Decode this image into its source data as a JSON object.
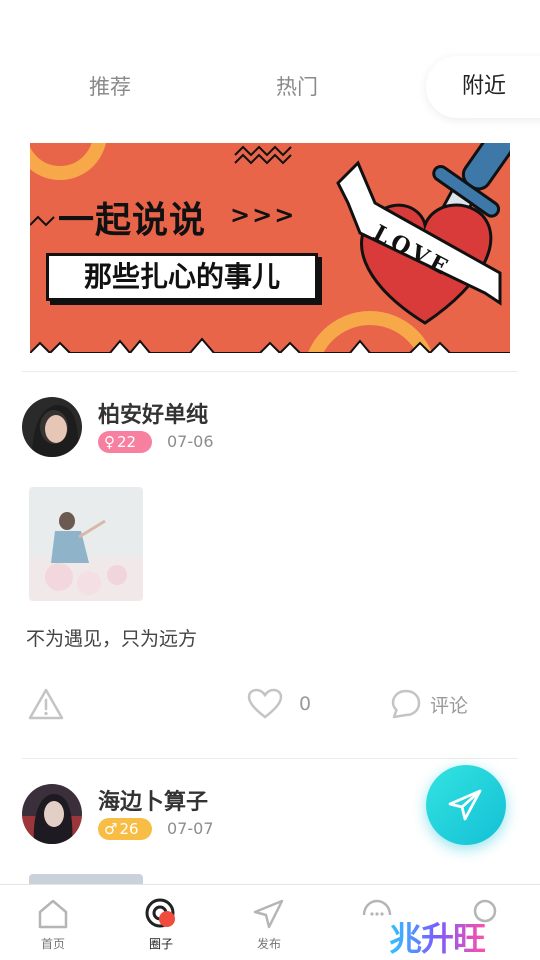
{
  "tabs": [
    {
      "label": "推荐",
      "active": false
    },
    {
      "label": "热门",
      "active": false
    },
    {
      "label": "附近",
      "active": true
    }
  ],
  "banner": {
    "title": "一起说说",
    "arrows": ">>>",
    "subtitle": "那些扎心的事儿",
    "heart_text": "LOVE",
    "background": "#e8654a"
  },
  "posts": [
    {
      "username": "柏安好单纯",
      "gender": "female",
      "gender_symbol": "♀",
      "age": "22",
      "date": "07-06",
      "text": "不为遇见，只为远方",
      "likes": "0",
      "comment_label": "评论"
    },
    {
      "username": "海边卜算子",
      "gender": "male",
      "gender_symbol": "♂",
      "age": "26",
      "date": "07-07"
    }
  ],
  "bottom_nav": [
    {
      "label": "首页",
      "icon": "home-icon",
      "active": false
    },
    {
      "label": "圈子",
      "icon": "circle-icon",
      "active": true
    },
    {
      "label": "发布",
      "icon": "send-icon",
      "active": false
    },
    {
      "label": "",
      "icon": "message-icon",
      "active": false
    },
    {
      "label": "",
      "icon": "user-icon",
      "active": false
    }
  ],
  "watermark": "兆升旺",
  "colors": {
    "accent_fab": "#13c0d6",
    "female_badge": "#f77fa0",
    "male_badge": "#f8bd45",
    "banner_red": "#e8654a"
  }
}
